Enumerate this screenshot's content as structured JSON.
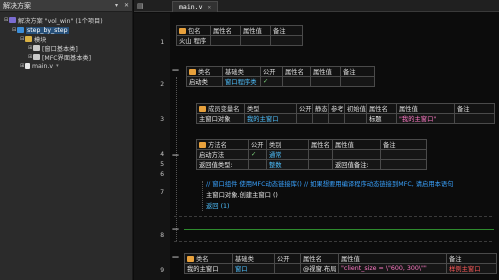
{
  "sidebar": {
    "title": "解决方案",
    "pin_icon": "pin-icon",
    "close_icon": "close-icon",
    "tree": [
      {
        "label": "解决方案 \"vol_win\" (1个项目)",
        "icon": "solution-icon",
        "expanded": true
      },
      {
        "label": "step_by_step",
        "icon": "project-icon",
        "expanded": true,
        "selected": true
      },
      {
        "label": "模块",
        "icon": "folder-icon",
        "expanded": true
      },
      {
        "label": "[窗口基本类]",
        "icon": "module-icon"
      },
      {
        "label": "[MFC界面基本类]",
        "icon": "module-icon"
      },
      {
        "label": "main.v",
        "icon": "file-icon"
      }
    ]
  },
  "editor": {
    "tab_label": "main.v",
    "line_numbers": [
      "1",
      "2",
      "3",
      "4",
      "5",
      "6",
      "7",
      "8",
      "9"
    ],
    "package_table": {
      "headers": [
        "包名",
        "属性名",
        "属性值",
        "备注"
      ],
      "row": [
        "火山 程序",
        "",
        "",
        ""
      ]
    },
    "class_table": {
      "headers": [
        "类名",
        "基础类",
        "公开",
        "属性名",
        "属性值",
        "备注"
      ],
      "row": [
        "启动类",
        "窗口程序类",
        "✓",
        "",
        "",
        ""
      ]
    },
    "member_table": {
      "headers": [
        "成员变量名",
        "类型",
        "公开",
        "静态",
        "参考",
        "初始值",
        "属性名",
        "属性值",
        "备注"
      ],
      "row": [
        "主窗口对象",
        "我的主窗口",
        "",
        "",
        "",
        "",
        "标题",
        "\"我的主窗口\"",
        ""
      ]
    },
    "method_table": {
      "headers": [
        "方法名",
        "公开",
        "类别",
        "属性名",
        "属性值",
        "备注"
      ],
      "rows": [
        [
          "启动方法",
          "✓",
          "通常",
          "",
          "",
          ""
        ],
        [
          "返回值类型:",
          "",
          "整数",
          "",
          "返回值备注:",
          ""
        ]
      ]
    },
    "code": {
      "comment": "// 窗口组件 使用MFC动态链接库() // 如果想要用编译程序动态链接到MFC, 请启用本语句",
      "statement": "主窗口对象.创建主窗口 ()",
      "return": "返回 (1)"
    },
    "window_class_table": {
      "headers": [
        "类名",
        "基础类",
        "公开",
        "属性名",
        "属性值",
        "备注"
      ],
      "row": [
        "我的主窗口",
        "窗口",
        "",
        "@视窗.布局",
        "\"client_size = \\\"600, 300\\\"\"",
        "样例主窗口"
      ]
    }
  }
}
